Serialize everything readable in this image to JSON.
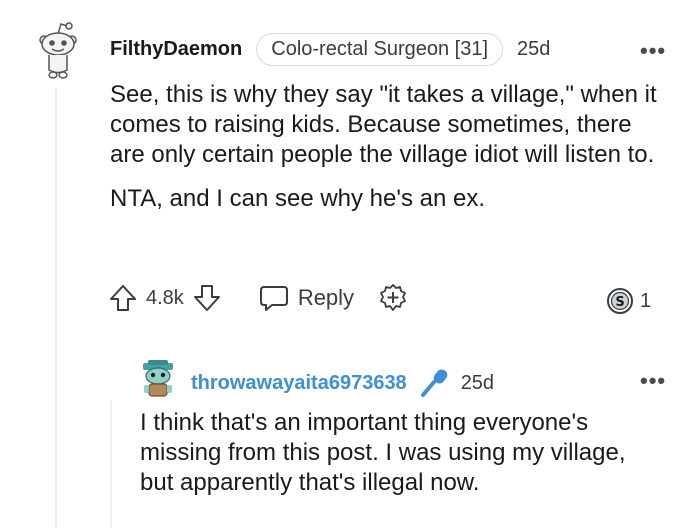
{
  "comment": {
    "username": "FilthyDaemon",
    "flair": "Colo-rectal Surgeon [31]",
    "age": "25d",
    "more": "•••",
    "paragraphs": [
      "See, this is why they say \"it takes a village,\" when it comes to raising kids. Because sometimes, there are only certain people the village idiot will listen to.",
      "NTA, and I can see why he's an ex."
    ],
    "votes": "4.8k",
    "reply_label": "Reply",
    "awards_count": "1"
  },
  "reply": {
    "username": "throwawayaita6973638",
    "age": "25d",
    "more": "•••",
    "text": "I think that's an important thing everyone's missing from this post. I was using my village, but apparently that's illegal now."
  },
  "colors": {
    "accent": "#3d8fd6",
    "icon": "#3a3c3e",
    "divider": "#edeff1"
  }
}
